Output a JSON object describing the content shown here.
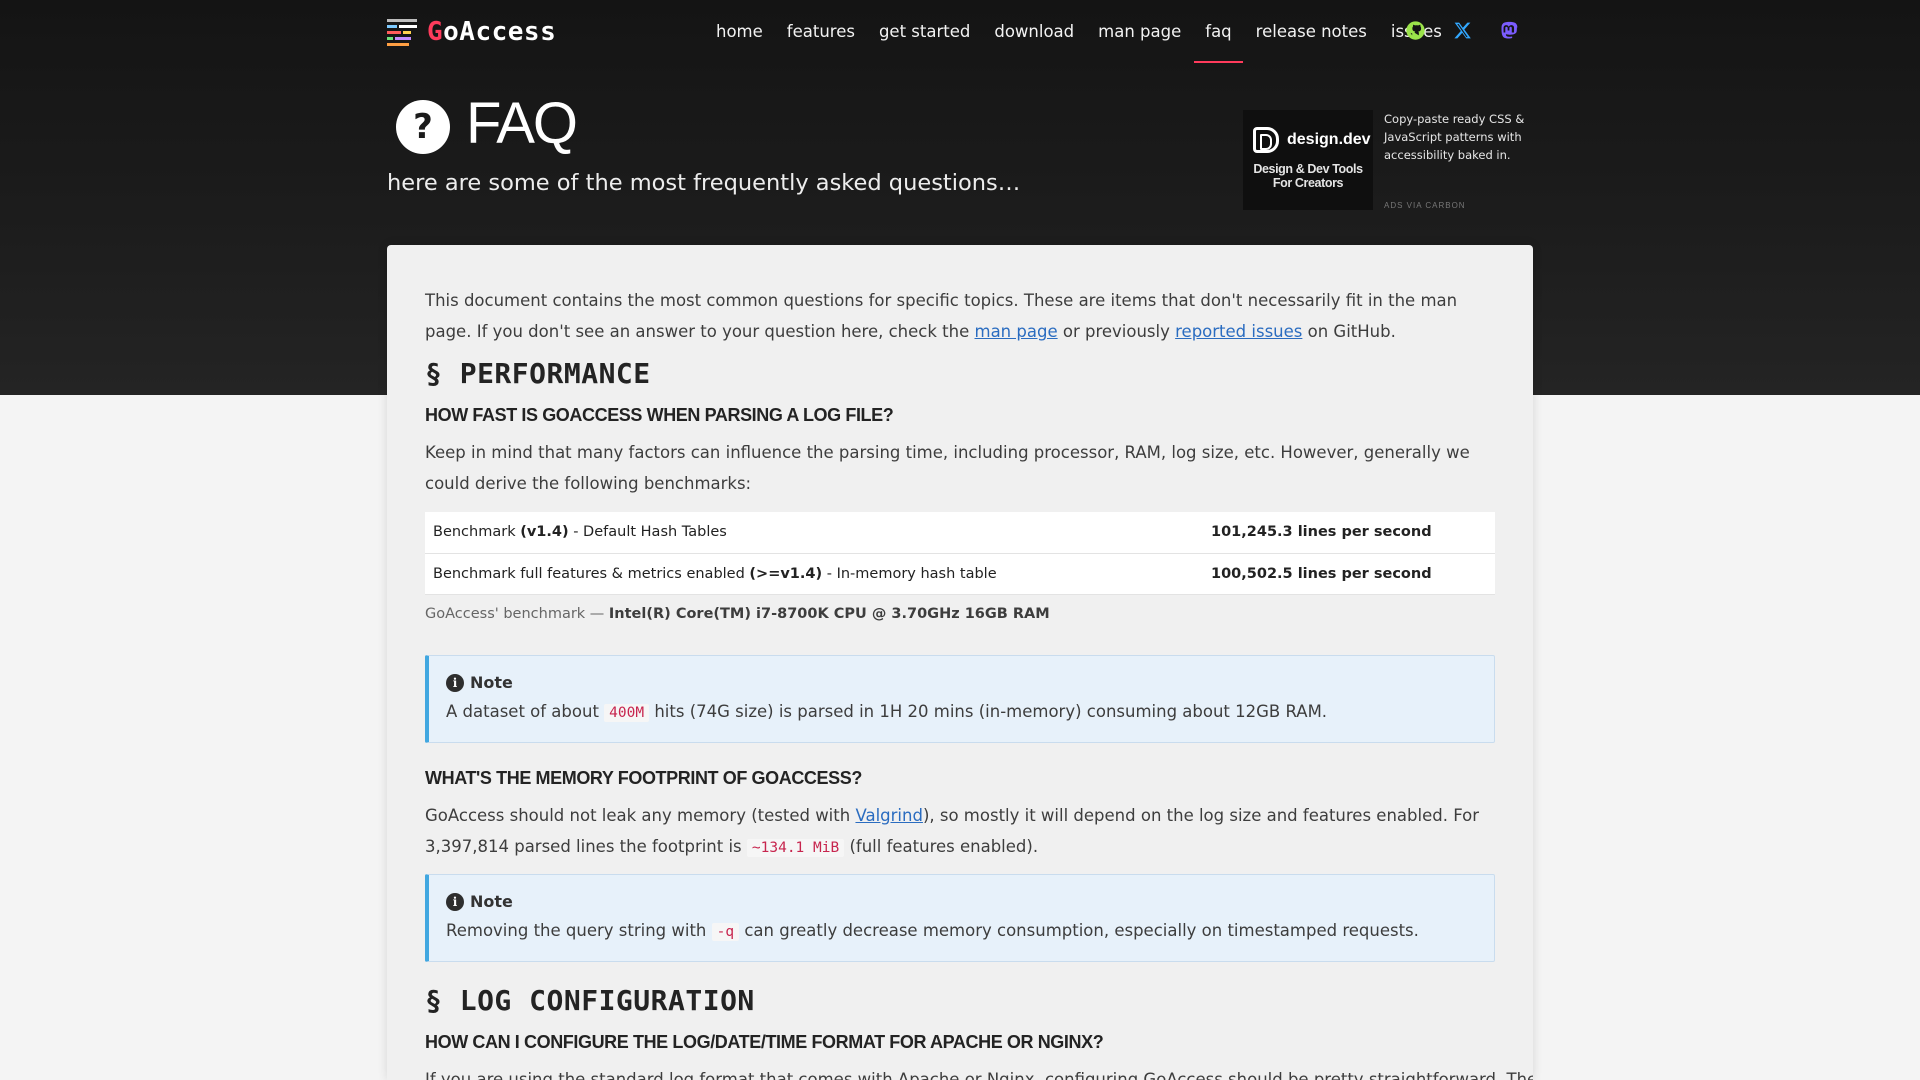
{
  "nav": {
    "logo": {
      "prefix": "G",
      "rest": "oAccess"
    },
    "links": [
      {
        "label": "home"
      },
      {
        "label": "features"
      },
      {
        "label": "get started"
      },
      {
        "label": "download"
      },
      {
        "label": "man page"
      },
      {
        "label": "faq",
        "active": true
      },
      {
        "label": "release notes"
      },
      {
        "label": "issues"
      }
    ],
    "icons": [
      "github-icon",
      "x-icon",
      "mastodon-icon"
    ]
  },
  "hero": {
    "title": "FAQ",
    "icon_glyph": "?",
    "subtitle": "here are some of the most frequently asked questions…"
  },
  "ad": {
    "brand": "design.dev",
    "tag_line1": "Design & Dev Tools",
    "tag_line2": "For Creators",
    "copy": "Copy-paste ready CSS & JavaScript patterns with accessibility baked in.",
    "via": "ADS VIA CARBON"
  },
  "content": {
    "intro_1": "This document contains the most common questions for specific topics. These are items that don't necessarily fit in the man page. If you don't see an answer to your question here, check the ",
    "intro_link_1": "man page",
    "intro_2": " or previously ",
    "intro_link_2": "reported issues",
    "intro_3": " on GitHub.",
    "section_performance": "§ PERFORMANCE",
    "q1": "HOW FAST IS GOACCESS WHEN PARSING A LOG FILE?",
    "q1_body": "Keep in mind that many factors can influence the parsing time, including processor, RAM, log size, etc. However, generally we could derive the following benchmarks:",
    "bench": [
      {
        "pre": "Benchmark ",
        "bold": "(v1.4)",
        "post": " - Default Hash Tables",
        "value": "101,245.3 lines per second"
      },
      {
        "pre": "Benchmark full features & metrics enabled ",
        "bold": "(>=v1.4)",
        "post": " - In-memory hash table",
        "value": "100,502.5 lines per second"
      }
    ],
    "caption_pre": "GoAccess' benchmark — ",
    "caption_bold": "Intel(R) Core(TM) i7-8700K CPU @ 3.70GHz 16GB RAM",
    "note_label": "Note",
    "note1_pre": "A dataset of about ",
    "note1_code": "400M",
    "note1_post": " hits (74G size) is parsed in 1H 20 mins (in-memory) consuming about 12GB RAM.",
    "q2": "WHAT'S THE MEMORY FOOTPRINT OF GOACCESS?",
    "q2_1": "GoAccess should not leak any memory (tested with ",
    "q2_link": "Valgrind",
    "q2_2": "), so mostly it will depend on the log size and features enabled. For 3,397,814 parsed lines the footprint is ",
    "q2_code": "~134.1 MiB",
    "q2_3": " (full features enabled).",
    "note2_pre": "Removing the query string with ",
    "note2_code": "-q",
    "note2_post": " can greatly decrease memory consumption, especially on timestamped requests.",
    "section_log": "§ LOG CONFIGURATION",
    "q3": "HOW CAN I CONFIGURE THE LOG/DATE/TIME FORMAT FOR APACHE OR NGINX?",
    "q3_body": "If you are using the standard log format that comes with Apache or Nginx, configuring GoAccess should be pretty straightforward. There are"
  },
  "colors": {
    "accent": "#ff3b5c",
    "link": "#2a6cc0",
    "note_border": "#41a7e0",
    "code": "#c7254e"
  }
}
